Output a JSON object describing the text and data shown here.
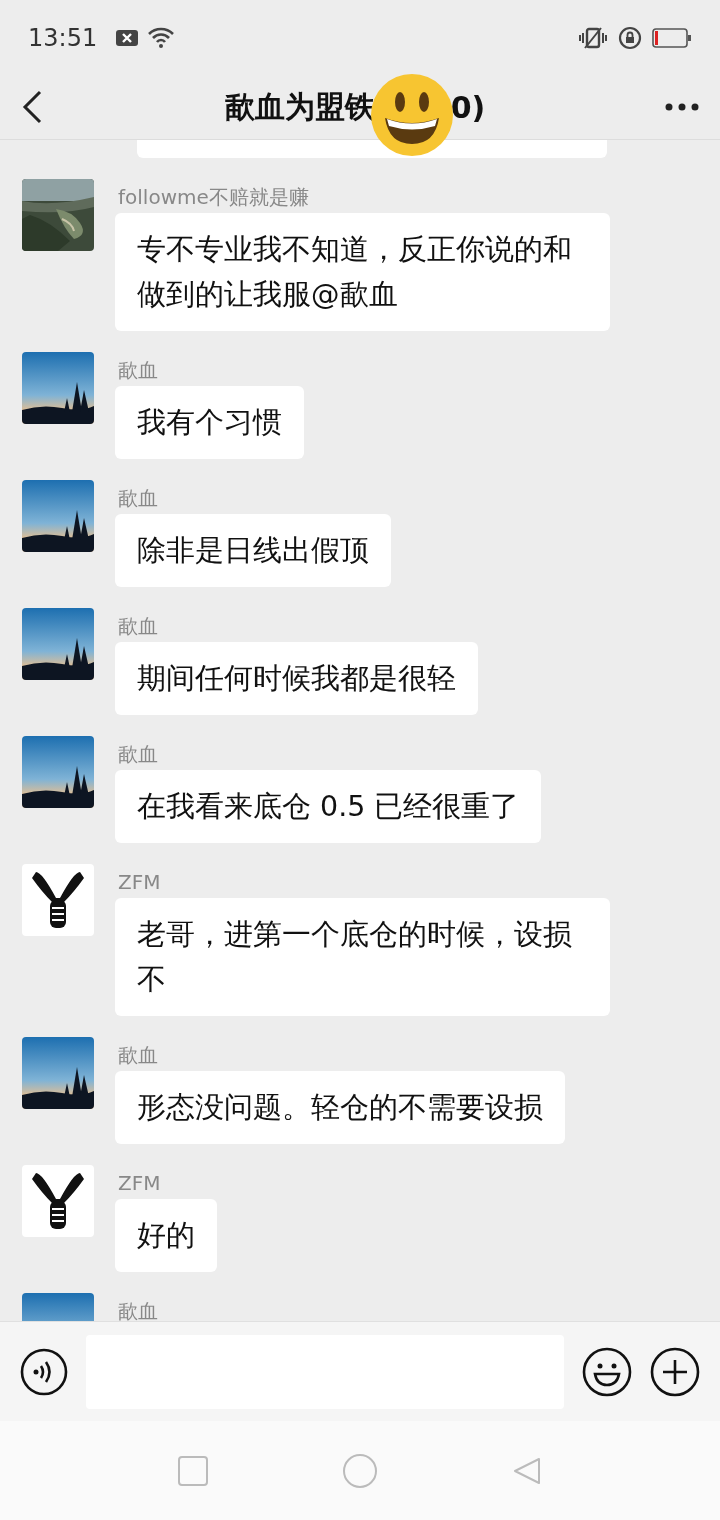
{
  "status_bar": {
    "time": "13:51"
  },
  "header": {
    "title_start": "歃血为盟铁",
    "title_end": "0)"
  },
  "messages": [
    {
      "kind": "stub"
    },
    {
      "kind": "message",
      "avatar": {
        "kind": "aerial"
      },
      "sender": "followme不赔就是赚",
      "text": "专不专业我不知道，反正你说的和做到的让我服@歃血"
    },
    {
      "kind": "message",
      "avatar": {
        "kind": "dusk"
      },
      "sender": "歃血",
      "text": "我有个习惯"
    },
    {
      "kind": "message",
      "avatar": {
        "kind": "dusk"
      },
      "sender": "歃血",
      "text": "除非是日线出假顶"
    },
    {
      "kind": "message",
      "avatar": {
        "kind": "dusk"
      },
      "sender": "歃血",
      "text": "期间任何时候我都是很轻"
    },
    {
      "kind": "message",
      "avatar": {
        "kind": "dusk"
      },
      "sender": "歃血",
      "text": "在我看来底仓 0.5 已经很重了"
    },
    {
      "kind": "message",
      "avatar": {
        "kind": "logo"
      },
      "sender": "ZFM",
      "text": "老哥，进第一个底仓的时候，设损不"
    },
    {
      "kind": "message",
      "avatar": {
        "kind": "dusk"
      },
      "sender": "歃血",
      "text": "形态没问题。轻仓的不需要设损"
    },
    {
      "kind": "message",
      "avatar": {
        "kind": "logo"
      },
      "sender": "ZFM",
      "text": "好的"
    },
    {
      "kind": "cut",
      "avatar": {
        "kind": "dusk"
      },
      "sender": "歃血"
    }
  ]
}
